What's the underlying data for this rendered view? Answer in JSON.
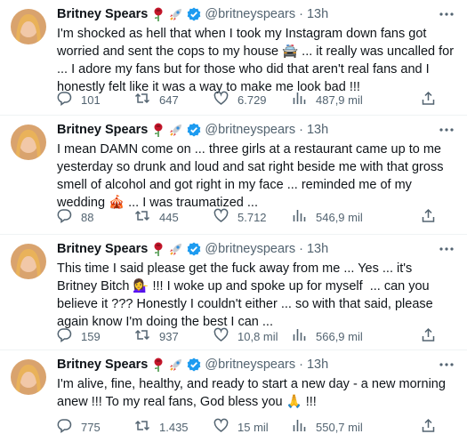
{
  "tweets": [
    {
      "name": "Britney Spears",
      "handle": "@britneyspears",
      "time": "13h",
      "text": "I'm shocked as hell that when I took my Instagram down fans got worried and sent the cops to my house 🚔 ... it really was uncalled for ... I adore my fans but for those who did that aren't real fans and I honestly felt like it was a way to make me look bad !!!",
      "replies": "101",
      "retweets": "647",
      "likes": "6.729",
      "views": "487,9 mil"
    },
    {
      "name": "Britney Spears",
      "handle": "@britneyspears",
      "time": "13h",
      "text": "I mean DAMN come on ... three girls at a restaurant came up to me yesterday so drunk and loud and sat right beside me with that gross smell of alcohol and got right in my face ... reminded me of my wedding 🎪 ... I was traumatized ...",
      "replies": "88",
      "retweets": "445",
      "likes": "5.712",
      "views": "546,9 mil"
    },
    {
      "name": "Britney Spears",
      "handle": "@britneyspears",
      "time": "13h",
      "text": "This time I said please get the fuck away from me ... Yes ... it's Britney Bitch 💁‍♀️ !!! I woke up and spoke up for myself  ... can you believe it ??? Honestly I couldn't either ... so with that said, please again know I'm doing the best I can ...",
      "replies": "159",
      "retweets": "937",
      "likes": "10,8 mil",
      "views": "566,9 mil"
    },
    {
      "name": "Britney Spears",
      "handle": "@britneyspears",
      "time": "13h",
      "text": "I'm alive, fine, healthy, and ready to start a new day - a new morning anew !!! To my real fans, God bless you 🙏 !!!",
      "replies": "775",
      "retweets": "1.435",
      "likes": "15 mil",
      "views": "550,7 mil"
    }
  ],
  "icons": {
    "name_emojis": [
      "rose-icon",
      "rocket-icon",
      "verified-badge-icon"
    ],
    "actions": [
      "reply-icon",
      "retweet-icon",
      "like-icon",
      "views-icon",
      "share-icon"
    ],
    "more": "more-options-icon"
  },
  "colors": {
    "text": "#0f1419",
    "secondary": "#536471",
    "verified": "#1d9bf0",
    "divider": "#eff3f4"
  }
}
